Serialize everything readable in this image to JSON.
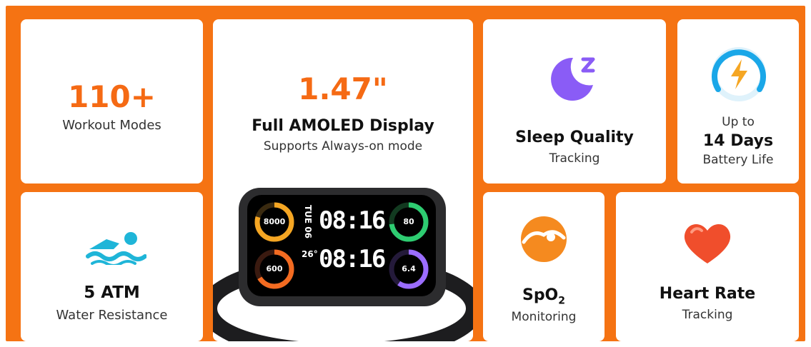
{
  "cards": {
    "workout": {
      "value": "110+",
      "label": "Workout Modes"
    },
    "display": {
      "value": "1.47\"",
      "title": "Full AMOLED Display",
      "subtitle": "Supports Always-on mode"
    },
    "sleep": {
      "title": "Sleep Quality",
      "subtitle": "Tracking"
    },
    "battery": {
      "pre": "Up to",
      "title": "14 Days",
      "subtitle": "Battery Life"
    },
    "water": {
      "title": "5 ATM",
      "subtitle": "Water Resistance"
    },
    "spo2": {
      "title_main": "SpO",
      "title_sub": "2",
      "subtitle": "Monitoring"
    },
    "heart": {
      "title": "Heart Rate",
      "subtitle": "Tracking"
    }
  },
  "watch": {
    "day": "TUE 06",
    "hour": "08:16",
    "time": "08:16",
    "temp": "26°",
    "rings": [
      "8000",
      "80",
      "600",
      "6.4"
    ]
  },
  "colors": {
    "background": "#f57313",
    "accent": "#f56a14",
    "sleep_icon": "#8a5cf6",
    "battery_icon": "#1aa7e8",
    "water_icon": "#1fb5d8",
    "spo2_icon": "#f58a1f",
    "heart_icon": "#f04e2c"
  }
}
